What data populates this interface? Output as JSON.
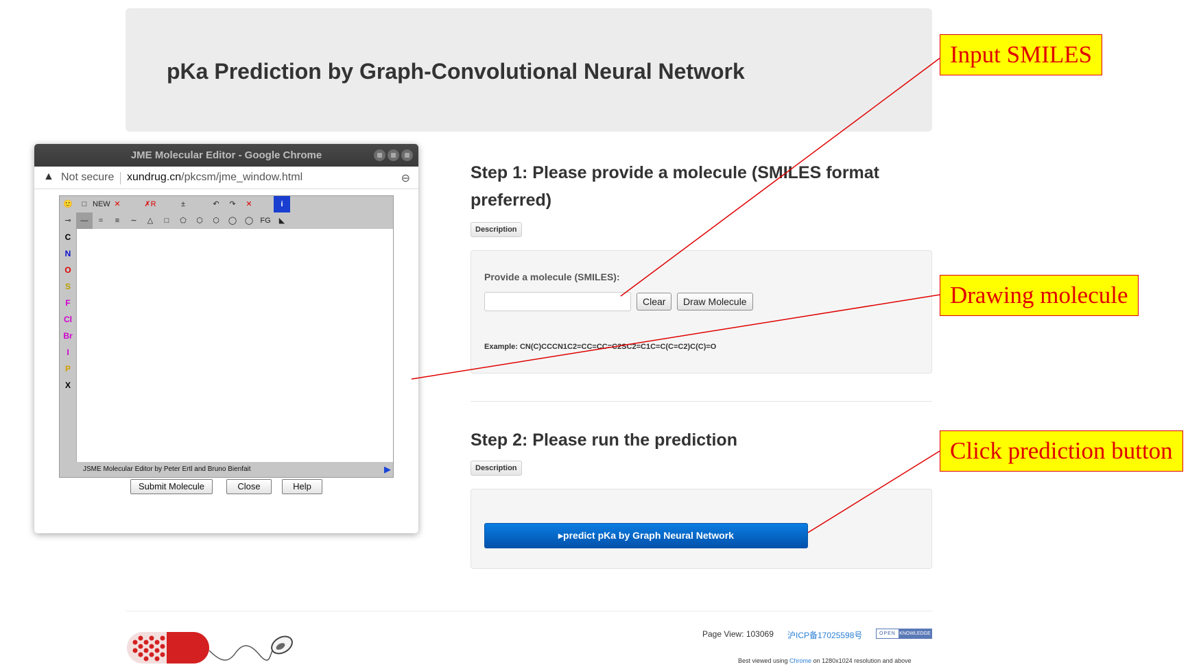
{
  "header": {
    "title": "pKa Prediction by Graph-Convolutional Neural Network"
  },
  "step1": {
    "title_line1": "Step 1: Please provide a molecule (SMILES format",
    "title_line2": "preferred)",
    "description_label": "Description",
    "input_label": "Provide a molecule (SMILES):",
    "input_value": "",
    "clear_label": "Clear",
    "draw_label": "Draw Molecule",
    "example": "Example: CN(C)CCCN1C2=CC=CC=C2SC2=C1C=C(C=C2)C(C)=O"
  },
  "step2": {
    "title": "Step 2: Please run the prediction",
    "description_label": "Description",
    "predict_label": "▸predict pKa by Graph Neural Network"
  },
  "footer": {
    "page_view": "Page View: 103069",
    "icp": "沪ICP备17025598号",
    "badge_left": "OPEN",
    "badge_right": "KNOWLEDGE",
    "best_viewed_pre": "Best viewed using ",
    "best_viewed_link": "Chrome",
    "best_viewed_post": " on 1280x1024 resolution and above"
  },
  "jme_window": {
    "title": "JME Molecular Editor - Google Chrome",
    "not_secure": "Not secure",
    "url_host": "xundrug.cn",
    "url_path": "/pkcsm/jme_window.html",
    "toolbar_row1": [
      "🙂",
      "□",
      "NEW",
      "✕",
      "",
      "✗R",
      "",
      "±",
      "",
      "↶",
      "↷",
      "✕",
      "",
      "i"
    ],
    "toolbar_row2": [
      "⊸",
      "—",
      "=",
      "≡",
      "∼",
      "△",
      "□",
      "⬠",
      "⬡",
      "⬡",
      "◯",
      "◯",
      "FG",
      "◣"
    ],
    "atoms": [
      "C",
      "N",
      "O",
      "S",
      "F",
      "Cl",
      "Br",
      "I",
      "P",
      "X"
    ],
    "atom_colors": [
      "#000000",
      "#1010d0",
      "#e00000",
      "#b8a000",
      "#d000d0",
      "#d000d0",
      "#d000d0",
      "#d000d0",
      "#d0a000",
      "#000000"
    ],
    "status": "JSME Molecular Editor by Peter Ertl and Bruno Bienfait",
    "submit_label": "Submit Molecule",
    "close_label": "Close",
    "help_label": "Help"
  },
  "callouts": {
    "input_smiles": "Input SMILES",
    "drawing_molecule": "Drawing molecule",
    "click_prediction": "Click prediction button"
  },
  "colors": {
    "accent_red": "#e00000",
    "callout_bg": "#ffff00",
    "predict_blue": "#0a6ad0"
  }
}
